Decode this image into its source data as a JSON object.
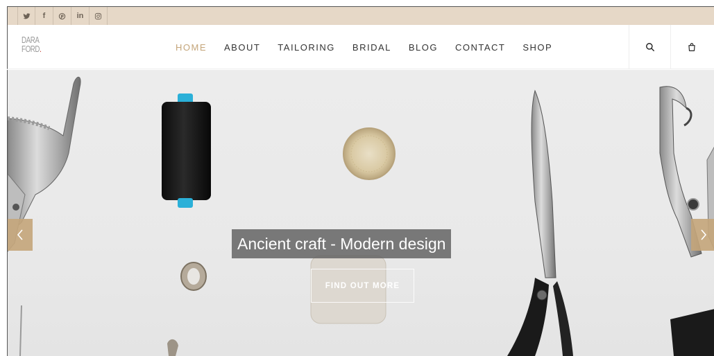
{
  "social": {
    "items": [
      {
        "icon": "twitter-icon"
      },
      {
        "icon": "facebook-icon",
        "glyph": "f"
      },
      {
        "icon": "pinterest-icon"
      },
      {
        "icon": "linkedin-icon",
        "glyph": "in"
      },
      {
        "icon": "instagram-icon"
      }
    ]
  },
  "header": {
    "logo_line1": "DARA",
    "logo_line2": "FORD",
    "logo_dot": ".",
    "nav": [
      "HOME",
      "ABOUT",
      "TAILORING",
      "BRIDAL",
      "BLOG",
      "CONTACT",
      "SHOP"
    ],
    "active_nav": "HOME",
    "search_icon": "search-icon",
    "bag_icon": "shopping-bag-icon"
  },
  "hero": {
    "title": "Ancient craft - Modern design",
    "cta": "FIND OUT MORE",
    "prev_icon": "chevron-left-icon",
    "next_icon": "chevron-right-icon"
  },
  "colors": {
    "accent": "#c4a57a",
    "topbar": "#e6d8c7",
    "thread_cap": "#2bb0d8"
  }
}
